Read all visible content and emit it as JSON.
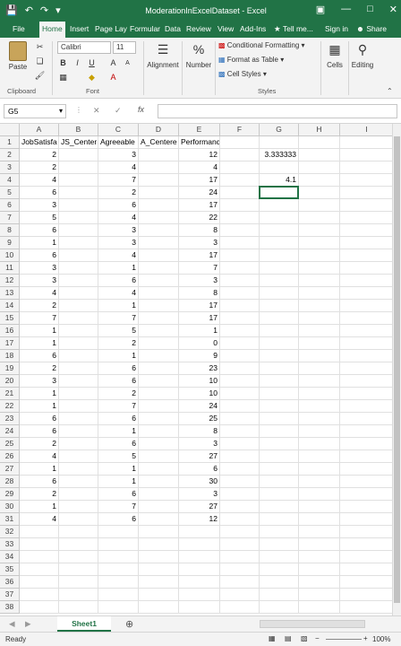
{
  "window": {
    "title": "ModerationInExcelDataset - Excel"
  },
  "tabs": [
    "File",
    "Home",
    "Insert",
    "Page Lay",
    "Formular",
    "Data",
    "Review",
    "View",
    "Add-Ins"
  ],
  "active_tab": "Home",
  "tell_me": "Tell me...",
  "sign_in": "Sign in",
  "share": "Share",
  "ribbon": {
    "paste_label": "Paste",
    "clipboard_label": "Clipboard",
    "font_name": "Calibri",
    "font_size": "11",
    "font_label": "Font",
    "alignment_label": "Alignment",
    "number_label": "Number",
    "number_symbol": "%",
    "conditional_formatting": "Conditional Formatting",
    "format_as_table": "Format as Table",
    "cell_styles": "Cell Styles",
    "styles_label": "Styles",
    "cells_label": "Cells",
    "editing_label": "Editing"
  },
  "formula_bar": {
    "name_box": "G5",
    "fx": "fx",
    "content": ""
  },
  "columns": [
    "A",
    "B",
    "C",
    "D",
    "E",
    "F",
    "G",
    "H",
    "I"
  ],
  "headers_row": [
    "JobSatisfa",
    "JS_Center",
    "Agreeable",
    "A_Centere",
    "Performance",
    "",
    "",
    "",
    ""
  ],
  "rows": [
    {
      "a": "2",
      "c": "3",
      "e": "12",
      "g": "3.333333"
    },
    {
      "a": "2",
      "c": "4",
      "e": "4",
      "g": ""
    },
    {
      "a": "4",
      "c": "7",
      "e": "17",
      "g": "4.1"
    },
    {
      "a": "6",
      "c": "2",
      "e": "24",
      "g": ""
    },
    {
      "a": "3",
      "c": "6",
      "e": "17",
      "g": ""
    },
    {
      "a": "5",
      "c": "4",
      "e": "22",
      "g": ""
    },
    {
      "a": "6",
      "c": "3",
      "e": "8",
      "g": ""
    },
    {
      "a": "1",
      "c": "3",
      "e": "3",
      "g": ""
    },
    {
      "a": "6",
      "c": "4",
      "e": "17",
      "g": ""
    },
    {
      "a": "3",
      "c": "1",
      "e": "7",
      "g": ""
    },
    {
      "a": "3",
      "c": "6",
      "e": "3",
      "g": ""
    },
    {
      "a": "4",
      "c": "4",
      "e": "8",
      "g": ""
    },
    {
      "a": "2",
      "c": "1",
      "e": "17",
      "g": ""
    },
    {
      "a": "7",
      "c": "7",
      "e": "17",
      "g": ""
    },
    {
      "a": "1",
      "c": "5",
      "e": "1",
      "g": ""
    },
    {
      "a": "1",
      "c": "2",
      "e": "0",
      "g": ""
    },
    {
      "a": "6",
      "c": "1",
      "e": "9",
      "g": ""
    },
    {
      "a": "2",
      "c": "6",
      "e": "23",
      "g": ""
    },
    {
      "a": "3",
      "c": "6",
      "e": "10",
      "g": ""
    },
    {
      "a": "1",
      "c": "2",
      "e": "10",
      "g": ""
    },
    {
      "a": "1",
      "c": "7",
      "e": "24",
      "g": ""
    },
    {
      "a": "6",
      "c": "6",
      "e": "25",
      "g": ""
    },
    {
      "a": "6",
      "c": "1",
      "e": "8",
      "g": ""
    },
    {
      "a": "2",
      "c": "6",
      "e": "3",
      "g": ""
    },
    {
      "a": "4",
      "c": "5",
      "e": "27",
      "g": ""
    },
    {
      "a": "1",
      "c": "1",
      "e": "6",
      "g": ""
    },
    {
      "a": "6",
      "c": "1",
      "e": "30",
      "g": ""
    },
    {
      "a": "2",
      "c": "6",
      "e": "3",
      "g": ""
    },
    {
      "a": "1",
      "c": "7",
      "e": "27",
      "g": ""
    },
    {
      "a": "4",
      "c": "6",
      "e": "12",
      "g": ""
    }
  ],
  "sheet_tab": "Sheet1",
  "status": {
    "ready": "Ready",
    "zoom": "100%"
  }
}
